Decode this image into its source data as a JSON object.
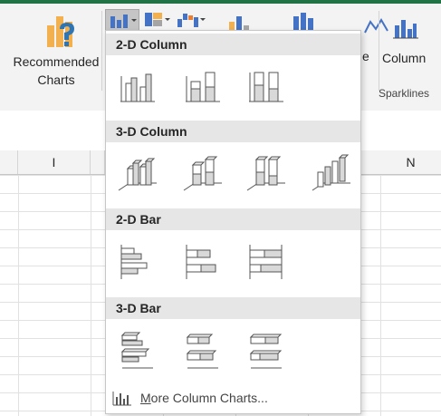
{
  "ribbon": {
    "recommended_charts_label": "Recommended Charts",
    "right_partial_label": "e",
    "column_sparkline_label": "Column",
    "sparklines_group_label": "Sparklines"
  },
  "sheet": {
    "columns": [
      "I",
      "N"
    ]
  },
  "dropdown": {
    "sections": [
      {
        "title": "2-D Column",
        "options": [
          "clustered-column",
          "stacked-column",
          "100-stacked-column"
        ]
      },
      {
        "title": "3-D Column",
        "options": [
          "3d-clustered-column",
          "3d-stacked-column",
          "3d-100-stacked-column",
          "3d-column"
        ]
      },
      {
        "title": "2-D Bar",
        "options": [
          "clustered-bar",
          "stacked-bar",
          "100-stacked-bar"
        ]
      },
      {
        "title": "3-D Bar",
        "options": [
          "3d-clustered-bar",
          "3d-stacked-bar",
          "3d-100-stacked-bar"
        ]
      }
    ],
    "more_link": "More Column Charts..."
  },
  "colors": {
    "accent_green": "#217346",
    "ribbon_bg": "#f3f3f3",
    "section_header_bg": "#e6e6e6",
    "icon_blue": "#4472c4",
    "icon_orange": "#ed7d31"
  }
}
